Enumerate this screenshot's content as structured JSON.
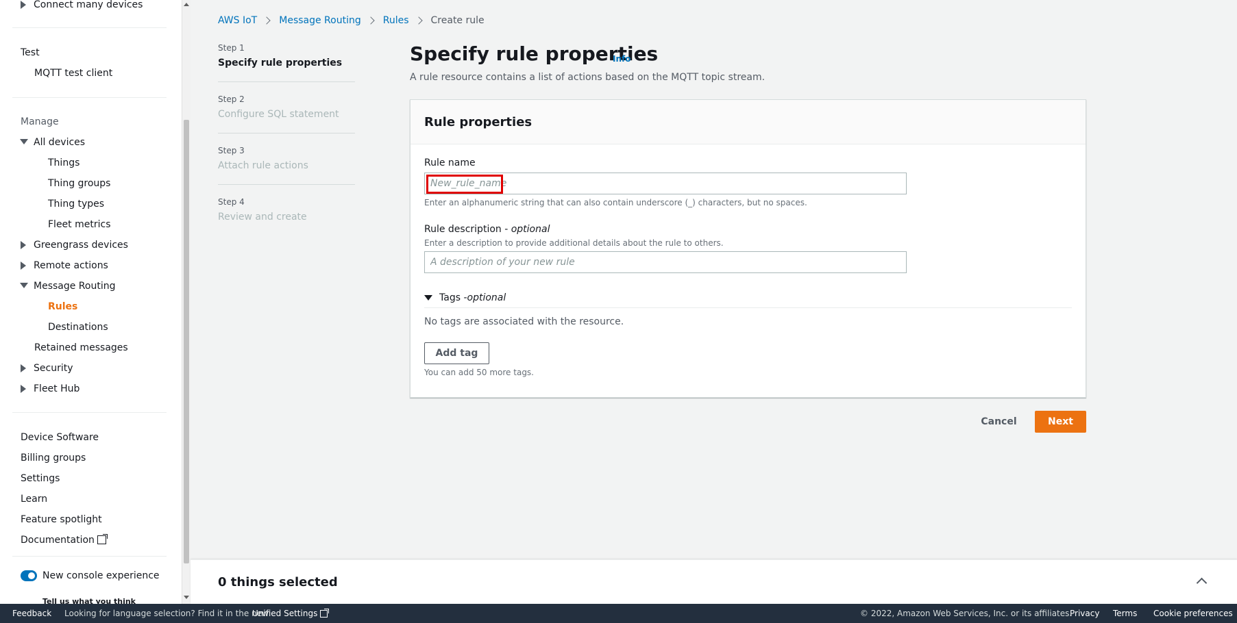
{
  "sidebar": {
    "items": [
      {
        "key": "connect_many",
        "label": "Connect many devices"
      },
      {
        "key": "test",
        "label": "Test"
      },
      {
        "key": "mqtt",
        "label": "MQTT test client"
      },
      {
        "key": "manage",
        "label": "Manage"
      },
      {
        "key": "all_devices",
        "label": "All devices"
      },
      {
        "key": "things",
        "label": "Things"
      },
      {
        "key": "thing_groups",
        "label": "Thing groups"
      },
      {
        "key": "thing_types",
        "label": "Thing types"
      },
      {
        "key": "fleet_metrics",
        "label": "Fleet metrics"
      },
      {
        "key": "greengrass",
        "label": "Greengrass devices"
      },
      {
        "key": "remote_actions",
        "label": "Remote actions"
      },
      {
        "key": "message_routing",
        "label": "Message Routing"
      },
      {
        "key": "rules",
        "label": "Rules"
      },
      {
        "key": "destinations",
        "label": "Destinations"
      },
      {
        "key": "retained",
        "label": "Retained messages"
      },
      {
        "key": "security",
        "label": "Security"
      },
      {
        "key": "fleet_hub",
        "label": "Fleet Hub"
      },
      {
        "key": "device_software",
        "label": "Device Software"
      },
      {
        "key": "billing_groups",
        "label": "Billing groups"
      },
      {
        "key": "settings",
        "label": "Settings"
      },
      {
        "key": "learn",
        "label": "Learn"
      },
      {
        "key": "feature_spotlight",
        "label": "Feature spotlight"
      },
      {
        "key": "documentation",
        "label": "Documentation"
      }
    ],
    "toggle_label": "New console experience",
    "feedback_link": "Tell us what you think"
  },
  "breadcrumb": [
    "AWS IoT",
    "Message Routing",
    "Rules",
    "Create rule"
  ],
  "steps": [
    {
      "label": "Step 1",
      "title": "Specify rule properties"
    },
    {
      "label": "Step 2",
      "title": "Configure SQL statement"
    },
    {
      "label": "Step 3",
      "title": "Attach rule actions"
    },
    {
      "label": "Step 4",
      "title": "Review and create"
    }
  ],
  "main": {
    "title": "Specify rule properties",
    "info": "Info",
    "description": "A rule resource contains a list of actions based on the MQTT topic stream."
  },
  "panel": {
    "title": "Rule properties",
    "rule_name_label": "Rule name",
    "rule_name_placeholder": "New_rule_name",
    "rule_name_hint": "Enter an alphanumeric string that can also contain underscore (_) characters, but no spaces.",
    "desc_label": "Rule description - ",
    "desc_optional": "optional",
    "desc_hint": "Enter a description to provide additional details about the rule to others.",
    "desc_placeholder": "A description of your new rule",
    "tags_label": "Tags - ",
    "tags_optional": "optional",
    "no_tags": "No tags are associated with the resource.",
    "add_tag": "Add tag",
    "tags_left": "You can add 50 more tags."
  },
  "actions": {
    "cancel": "Cancel",
    "next": "Next"
  },
  "split_panel": {
    "title": "0 things selected"
  },
  "footer": {
    "feedback": "Feedback",
    "language_note": "Looking for language selection? Find it in the new",
    "unified_settings": "Unified Settings",
    "copyright": "© 2022, Amazon Web Services, Inc. or its affiliates.",
    "privacy": "Privacy",
    "terms": "Terms",
    "cookies": "Cookie preferences"
  },
  "colors": {
    "accent": "#ec7211",
    "link": "#0073bb",
    "footer_bg": "#232f3e"
  }
}
